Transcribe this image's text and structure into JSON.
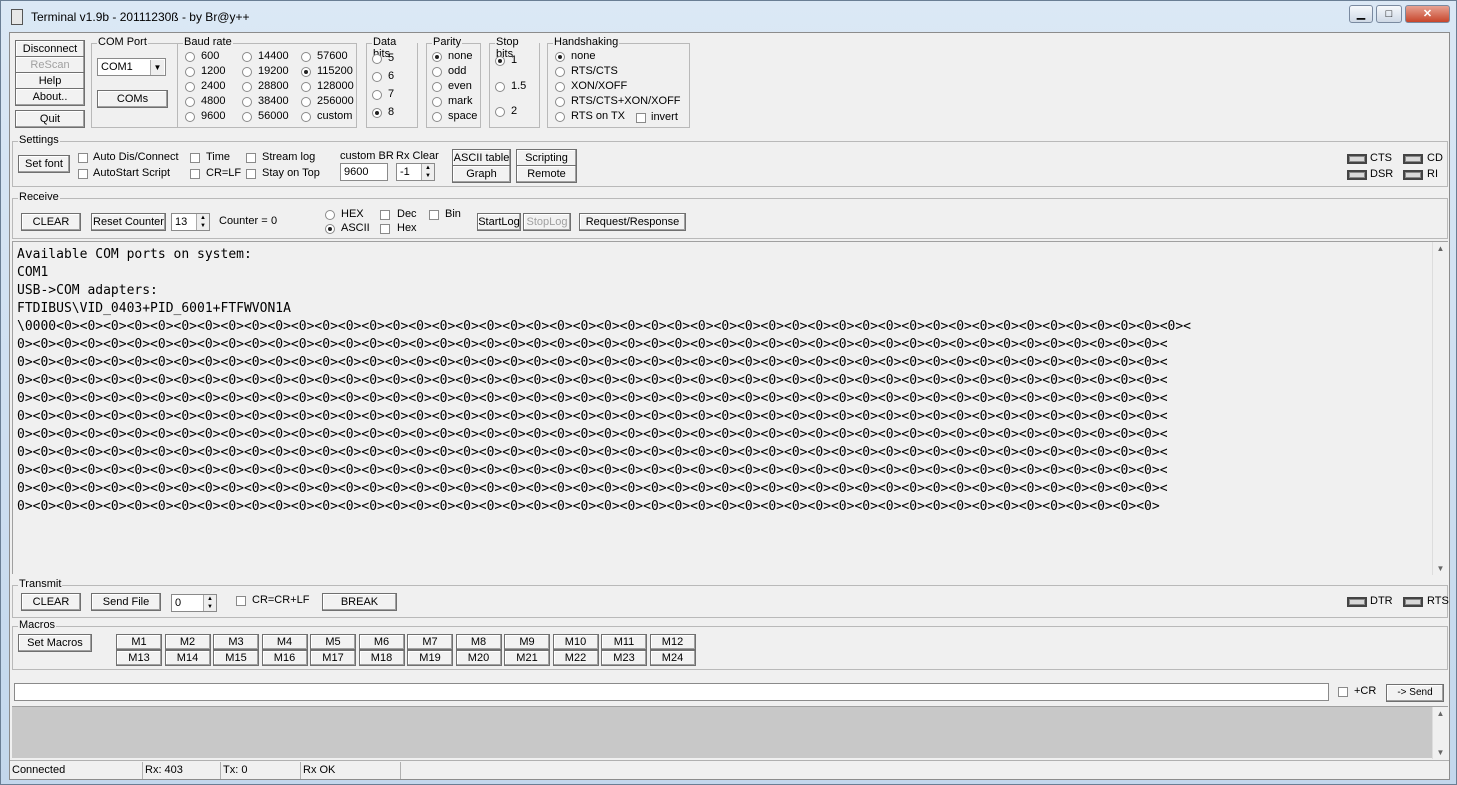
{
  "window": {
    "title": "Terminal v1.9b - 20111230ß - by Br@y++",
    "minimize_glyph": "▁",
    "maximize_glyph": "□",
    "close_glyph": "✕"
  },
  "connection_buttons": {
    "disconnect": "Disconnect",
    "rescan": "ReScan",
    "help": "Help",
    "about": "About..",
    "quit": "Quit"
  },
  "com_port": {
    "label": "COM Port",
    "selected": "COM1",
    "coms_button": "COMs"
  },
  "baud_rate": {
    "label": "Baud rate",
    "options": [
      "600",
      "1200",
      "2400",
      "4800",
      "9600",
      "14400",
      "19200",
      "28800",
      "38400",
      "56000",
      "57600",
      "115200",
      "128000",
      "256000",
      "custom"
    ],
    "selected": "115200"
  },
  "data_bits": {
    "label": "Data bits",
    "options": [
      "5",
      "6",
      "7",
      "8"
    ],
    "selected": "8"
  },
  "parity": {
    "label": "Parity",
    "options": [
      "none",
      "odd",
      "even",
      "mark",
      "space"
    ],
    "selected": "none"
  },
  "stop_bits": {
    "label": "Stop bits",
    "options": [
      "1",
      "1.5",
      "2"
    ],
    "selected": "1"
  },
  "handshaking": {
    "label": "Handshaking",
    "options": [
      "none",
      "RTS/CTS",
      "XON/XOFF",
      "RTS/CTS+XON/XOFF",
      "RTS on TX"
    ],
    "selected": "none",
    "invert_label": "invert"
  },
  "settings": {
    "label": "Settings",
    "set_font": "Set font",
    "auto_dis_connect": "Auto Dis/Connect",
    "autostart_script": "AutoStart Script",
    "time": "Time",
    "cr_lf": "CR=LF",
    "stream_log": "Stream log",
    "stay_on_top": "Stay on Top",
    "custom_br_label": "custom BR",
    "custom_br_value": "9600",
    "rx_clear_label": "Rx Clear",
    "rx_clear_value": "-1",
    "ascii_table": "ASCII table",
    "scripting": "Scripting",
    "graph": "Graph",
    "remote": "Remote",
    "cts": "CTS",
    "cd": "CD",
    "dsr": "DSR",
    "ri": "RI"
  },
  "receive": {
    "label": "Receive",
    "clear": "CLEAR",
    "reset_counter": "Reset Counter",
    "counter_spin": "13",
    "counter_label": "Counter =",
    "counter_value": "0",
    "hex": "HEX",
    "ascii": "ASCII",
    "format_selected": "ASCII",
    "dec": "Dec",
    "hex_chk": "Hex",
    "bin": "Bin",
    "startlog": "StartLog",
    "stoplog": "StopLog",
    "request_response": "Request/Response",
    "lines": [
      "Available COM ports on system:",
      "COM1",
      "USB->COM adapters:",
      "FTDIBUS\\VID_0403+PID_6001+FTFWVON1A",
      "\\0000<0><0><0><0><0><0><0><0><0><0><0><0><0><0><0><0><0><0><0><0><0><0><0><0><0><0><0><0><0><0><0><0><0><0><0><0><0><0><0><0><0><0><0><0><0><0><0><0><",
      "0><0><0><0><0><0><0><0><0><0><0><0><0><0><0><0><0><0><0><0><0><0><0><0><0><0><0><0><0><0><0><0><0><0><0><0><0><0><0><0><0><0><0><0><0><0><0><0><0><",
      "0><0><0><0><0><0><0><0><0><0><0><0><0><0><0><0><0><0><0><0><0><0><0><0><0><0><0><0><0><0><0><0><0><0><0><0><0><0><0><0><0><0><0><0><0><0><0><0><0><",
      "0><0><0><0><0><0><0><0><0><0><0><0><0><0><0><0><0><0><0><0><0><0><0><0><0><0><0><0><0><0><0><0><0><0><0><0><0><0><0><0><0><0><0><0><0><0><0><0><0><",
      "0><0><0><0><0><0><0><0><0><0><0><0><0><0><0><0><0><0><0><0><0><0><0><0><0><0><0><0><0><0><0><0><0><0><0><0><0><0><0><0><0><0><0><0><0><0><0><0><0><",
      "0><0><0><0><0><0><0><0><0><0><0><0><0><0><0><0><0><0><0><0><0><0><0><0><0><0><0><0><0><0><0><0><0><0><0><0><0><0><0><0><0><0><0><0><0><0><0><0><0><",
      "0><0><0><0><0><0><0><0><0><0><0><0><0><0><0><0><0><0><0><0><0><0><0><0><0><0><0><0><0><0><0><0><0><0><0><0><0><0><0><0><0><0><0><0><0><0><0><0><0><",
      "0><0><0><0><0><0><0><0><0><0><0><0><0><0><0><0><0><0><0><0><0><0><0><0><0><0><0><0><0><0><0><0><0><0><0><0><0><0><0><0><0><0><0><0><0><0><0><0><0><",
      "0><0><0><0><0><0><0><0><0><0><0><0><0><0><0><0><0><0><0><0><0><0><0><0><0><0><0><0><0><0><0><0><0><0><0><0><0><0><0><0><0><0><0><0><0><0><0><0><0><",
      "0><0><0><0><0><0><0><0><0><0><0><0><0><0><0><0><0><0><0><0><0><0><0><0><0><0><0><0><0><0><0><0><0><0><0><0><0><0><0><0><0><0><0><0><0><0><0><0><0><",
      "0><0><0><0><0><0><0><0><0><0><0><0><0><0><0><0><0><0><0><0><0><0><0><0><0><0><0><0><0><0><0><0><0><0><0><0><0><0><0><0><0><0><0><0><0><0><0><0><0>"
    ]
  },
  "transmit": {
    "label": "Transmit",
    "clear": "CLEAR",
    "send_file": "Send File",
    "spin_value": "0",
    "cr_crlf": "CR=CR+LF",
    "break": "BREAK",
    "dtr": "DTR",
    "rts": "RTS"
  },
  "macros": {
    "label": "Macros",
    "set_macros": "Set Macros",
    "buttons": [
      "M1",
      "M2",
      "M3",
      "M4",
      "M5",
      "M6",
      "M7",
      "M8",
      "M9",
      "M10",
      "M11",
      "M12",
      "M13",
      "M14",
      "M15",
      "M16",
      "M17",
      "M18",
      "M19",
      "M20",
      "M21",
      "M22",
      "M23",
      "M24"
    ]
  },
  "send_bar": {
    "input_value": "",
    "plus_cr": "+CR",
    "send": "-> Send"
  },
  "status_bar": {
    "state": "Connected",
    "rx": "Rx: 403",
    "tx": "Tx: 0",
    "rx_state": "Rx OK"
  },
  "icons": {
    "scroll_up": "▲",
    "scroll_down": "▼",
    "dropdown": "▼",
    "spin_up": "▲",
    "spin_down": "▼"
  }
}
